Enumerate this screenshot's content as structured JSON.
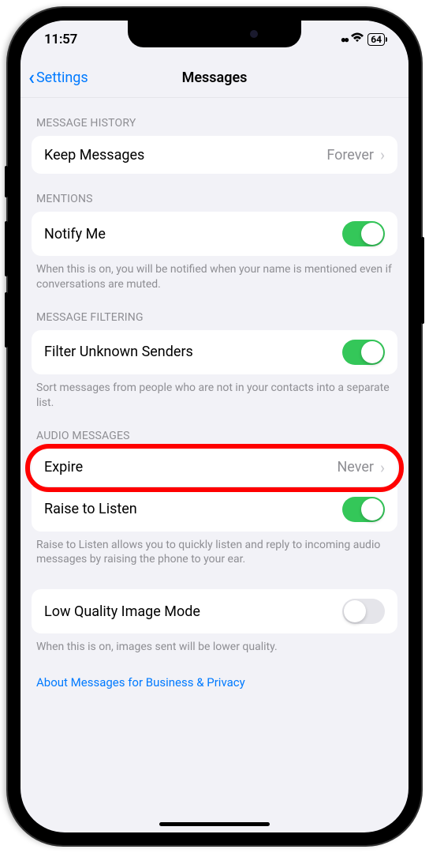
{
  "status": {
    "time": "11:57",
    "battery": "64"
  },
  "nav": {
    "back": "Settings",
    "title": "Messages"
  },
  "sections": {
    "history": {
      "header": "MESSAGE HISTORY",
      "keepMessages": {
        "label": "Keep Messages",
        "value": "Forever"
      }
    },
    "mentions": {
      "header": "MENTIONS",
      "notifyMe": {
        "label": "Notify Me",
        "on": true
      },
      "footer": "When this is on, you will be notified when your name is mentioned even if conversations are muted."
    },
    "filtering": {
      "header": "MESSAGE FILTERING",
      "filterUnknown": {
        "label": "Filter Unknown Senders",
        "on": true
      },
      "footer": "Sort messages from people who are not in your contacts into a separate list."
    },
    "audio": {
      "header": "AUDIO MESSAGES",
      "expire": {
        "label": "Expire",
        "value": "Never"
      },
      "raise": {
        "label": "Raise to Listen",
        "on": true
      },
      "footer": "Raise to Listen allows you to quickly listen and reply to incoming audio messages by raising the phone to your ear."
    },
    "lowQuality": {
      "label": "Low Quality Image Mode",
      "on": false,
      "footer": "When this is on, images sent will be lower quality."
    }
  },
  "link": "About Messages for Business & Privacy"
}
